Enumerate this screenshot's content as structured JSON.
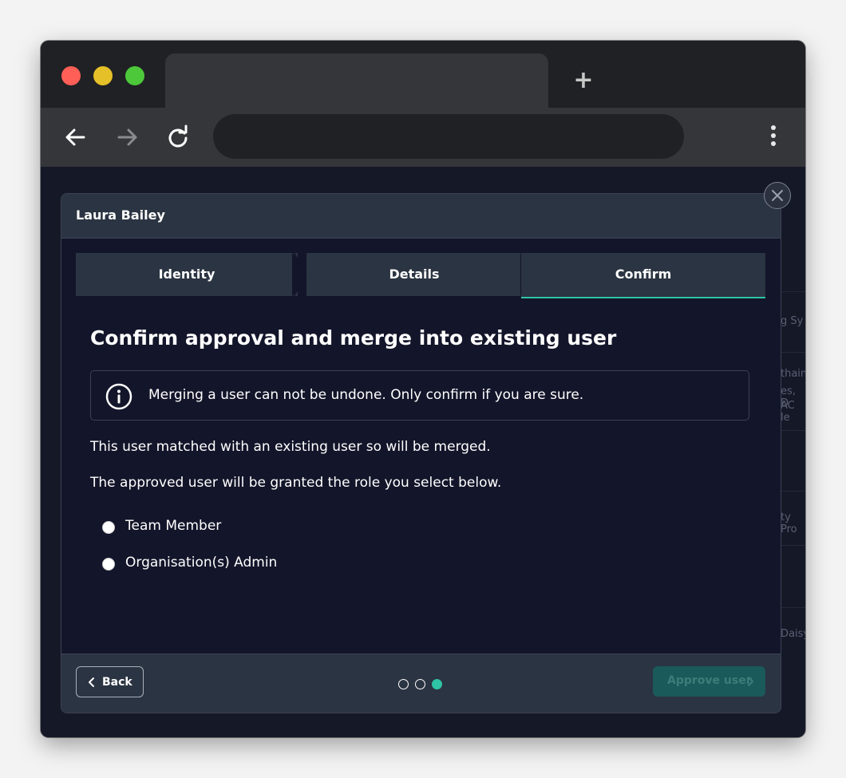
{
  "browser": {
    "new_tab_glyph": "+",
    "icons": [
      "back-arrow-icon",
      "forward-arrow-icon",
      "reload-icon",
      "more-vertical-icon"
    ]
  },
  "background": {
    "fragments": [
      "g Sy",
      "thain",
      "es, D",
      "AC le",
      "ty Pro",
      "Daisy"
    ]
  },
  "modal": {
    "title": "Laura Bailey",
    "steps": [
      {
        "label": "Identity",
        "active": false
      },
      {
        "label": "Details",
        "active": false
      },
      {
        "label": "Confirm",
        "active": true
      }
    ],
    "heading": "Confirm approval and merge into existing user",
    "alert": {
      "icon": "info-icon",
      "text": "Merging a user can not be undone. Only confirm if you are sure."
    },
    "paragraphs": [
      "This user matched with an existing user so will be merged.",
      "The approved user will be granted the role you select below."
    ],
    "roles": [
      {
        "label": "Team Member",
        "selected": false
      },
      {
        "label": "Organisation(s) Admin",
        "selected": false
      }
    ],
    "footer": {
      "back_label": "Back",
      "approve_label": "Approve user",
      "approve_disabled": true,
      "pager": {
        "total": 3,
        "current": 3
      }
    }
  },
  "colors": {
    "accent": "#2ec4a5",
    "modal_bg": "#13152a",
    "header_bg": "#2b3442",
    "approve_bg": "#1b5a5a"
  }
}
